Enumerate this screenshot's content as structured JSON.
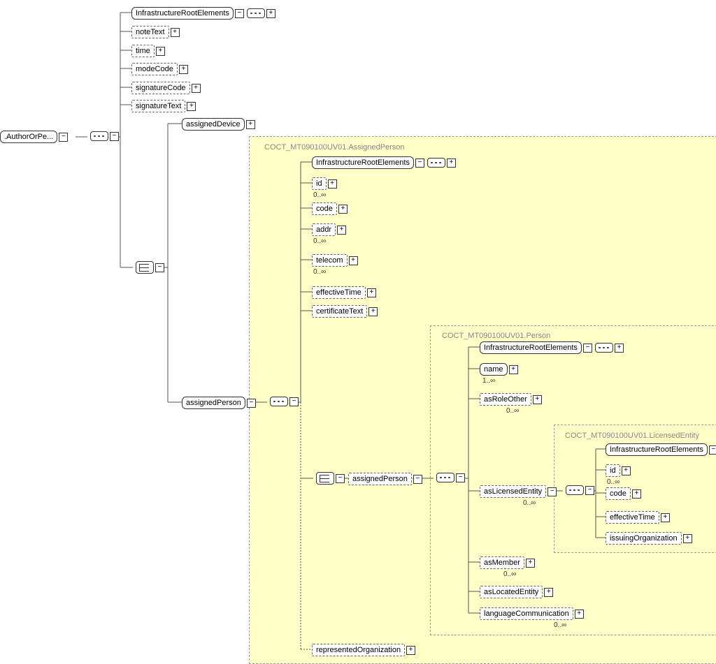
{
  "root": ".AuthorOrPe...",
  "infra": "InfrastructureRootElements",
  "noteText": "noteText",
  "time": "time",
  "modeCode": "modeCode",
  "signatureCode": "signatureCode",
  "signatureText": "signatureText",
  "assignedDevice": "assignedDevice",
  "assignedPerson": "assignedPerson",
  "group1": "COCT_MT090100UV01.AssignedPerson",
  "id": "id",
  "code": "code",
  "addr": "addr",
  "telecom": "telecom",
  "effectiveTime": "effectiveTime",
  "certificateText": "certificateText",
  "group2": "COCT_MT090100UV01.Person",
  "name": "name",
  "asRoleOther": "asRoleOther",
  "asLicensedEntity": "asLicensedEntity",
  "asMember": "asMember",
  "asLocatedEntity": "asLocatedEntity",
  "languageCommunication": "languageCommunication",
  "representedOrganization": "representedOrganization",
  "group3": "COCT_MT090100UV01.LicensedEntity",
  "issuingOrganization": "issuingOrganization",
  "card_0inf": "0..∞",
  "card_1inf": "1..∞",
  "plus": "+",
  "minus": "−"
}
